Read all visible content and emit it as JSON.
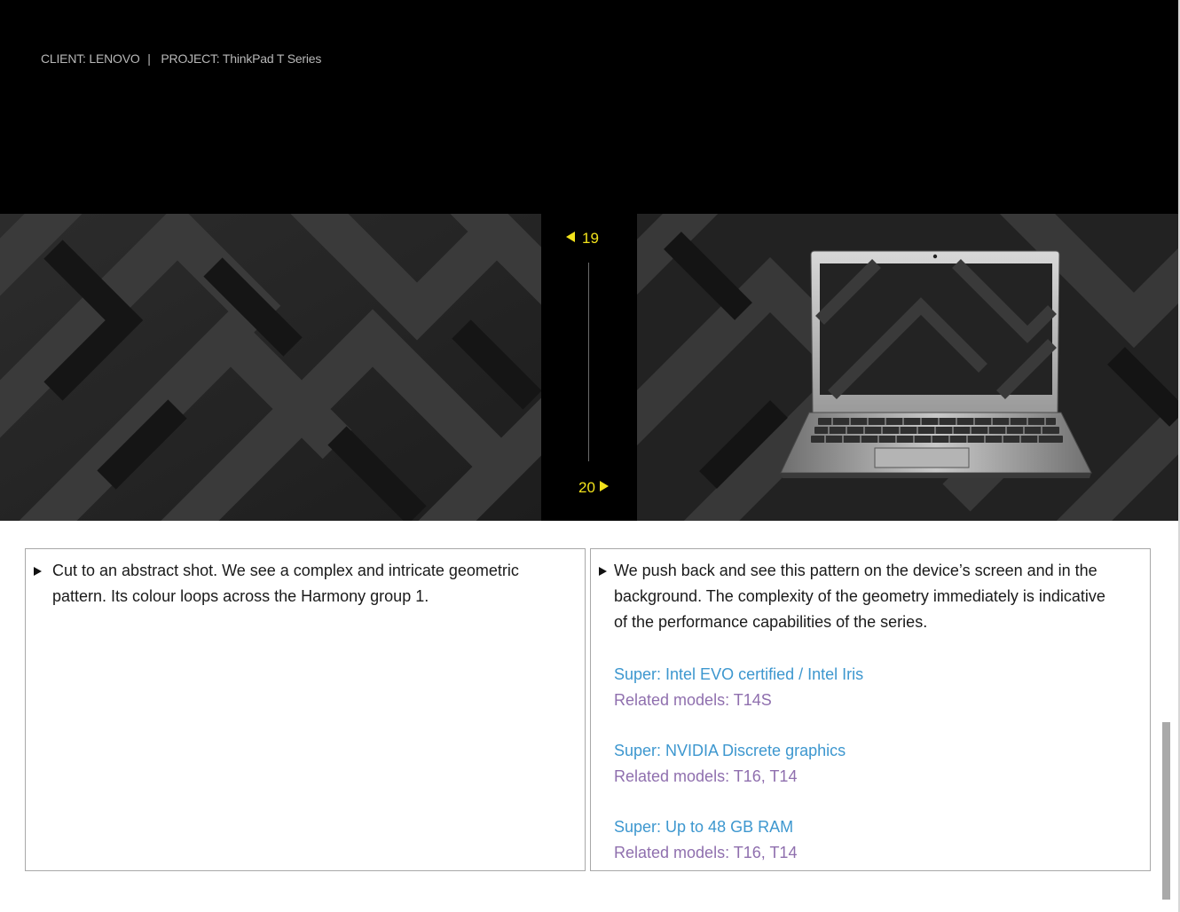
{
  "header": {
    "client": "CLIENT: LENOVO",
    "separator": "|",
    "project": "PROJECT: ThinkPad T Series"
  },
  "navigation": {
    "prev_page": "19",
    "next_page": "20",
    "accent_color": "#f2e21b"
  },
  "frames": [
    {
      "description": "Cut to an abstract shot. We see a complex and intricate geometric pattern. Its colour loops across the Harmony group 1."
    },
    {
      "description": "We push back and see this pattern on the device’s screen and in the background. The complexity of the geometry immediately is indicative of the performance capabilities of the series.",
      "features": [
        {
          "super": "Super: Intel EVO certified / Intel Iris",
          "models": "Related models: T14S"
        },
        {
          "super": "Super: NVIDIA Discrete graphics",
          "models": "Related models: T16, T14"
        },
        {
          "super": "Super: Up to 48 GB RAM",
          "models": "Related models: T16, T14"
        }
      ]
    }
  ],
  "colors": {
    "super_text": "#3d97cf",
    "models_text": "#8f6fae",
    "header_bg": "#000000"
  }
}
